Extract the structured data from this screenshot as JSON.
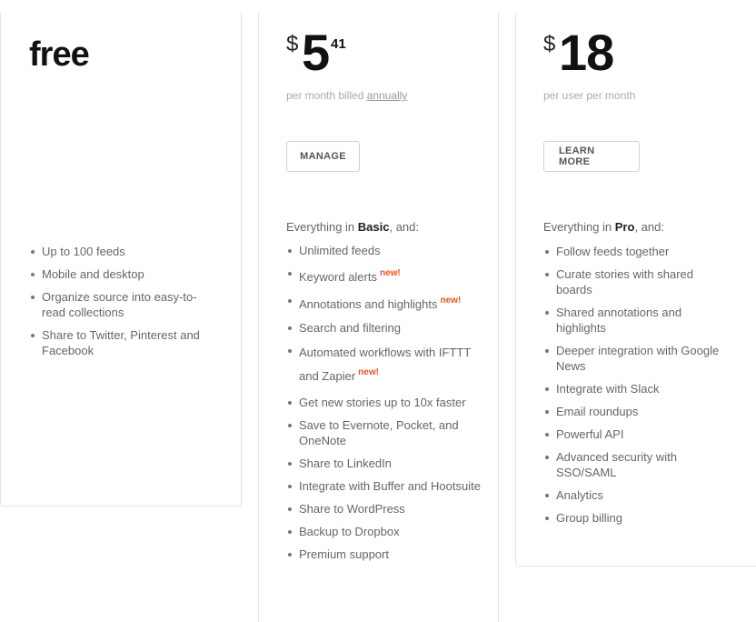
{
  "plans": [
    {
      "id": "free",
      "name": "free",
      "features": [
        "Up to 100 feeds",
        "Mobile and desktop",
        "Organize source into easy-to-read collections",
        "Share to Twitter, Pinterest and Facebook"
      ]
    },
    {
      "id": "basic",
      "currency": "$",
      "price_whole": "5",
      "price_cents": "41",
      "price_note": "per month billed",
      "price_note_link": "annually",
      "button_label": "MANAGE",
      "intro_prefix": "Everything in ",
      "intro_plan": "Basic",
      "intro_suffix": ", and:",
      "new_badge": "new!",
      "features": [
        {
          "text": "Unlimited feeds",
          "new": false
        },
        {
          "text": "Keyword alerts",
          "new": true
        },
        {
          "text": "Annotations and highlights",
          "new": true
        },
        {
          "text": "Search and filtering",
          "new": false
        },
        {
          "text": "Automated workflows with IFTTT and Zapier",
          "new": true
        },
        {
          "text": "Get new stories up to 10x faster",
          "new": false
        },
        {
          "text": "Save to Evernote, Pocket, and OneNote",
          "new": false
        },
        {
          "text": "Share to LinkedIn",
          "new": false
        },
        {
          "text": "Integrate with Buffer and Hootsuite",
          "new": false
        },
        {
          "text": "Share to WordPress",
          "new": false
        },
        {
          "text": "Backup to Dropbox",
          "new": false
        },
        {
          "text": "Premium support",
          "new": false
        }
      ]
    },
    {
      "id": "pro",
      "currency": "$",
      "price_whole": "18",
      "price_note": "per user per month",
      "button_label": "LEARN MORE",
      "intro_prefix": "Everything in ",
      "intro_plan": "Pro",
      "intro_suffix": ", and:",
      "features": [
        "Follow feeds together",
        "Curate stories with shared boards",
        "Shared annotations and highlights",
        "Deeper integration with Google News",
        "Integrate with Slack",
        "Email roundups",
        "Powerful API",
        "Advanced security with SSO/SAML",
        "Analytics",
        "Group billing"
      ]
    }
  ],
  "colors": {
    "new_badge": "#e8551f",
    "card_border": "#e2e4e7",
    "price_text": "#111111",
    "muted_text": "#aaaaaa"
  }
}
